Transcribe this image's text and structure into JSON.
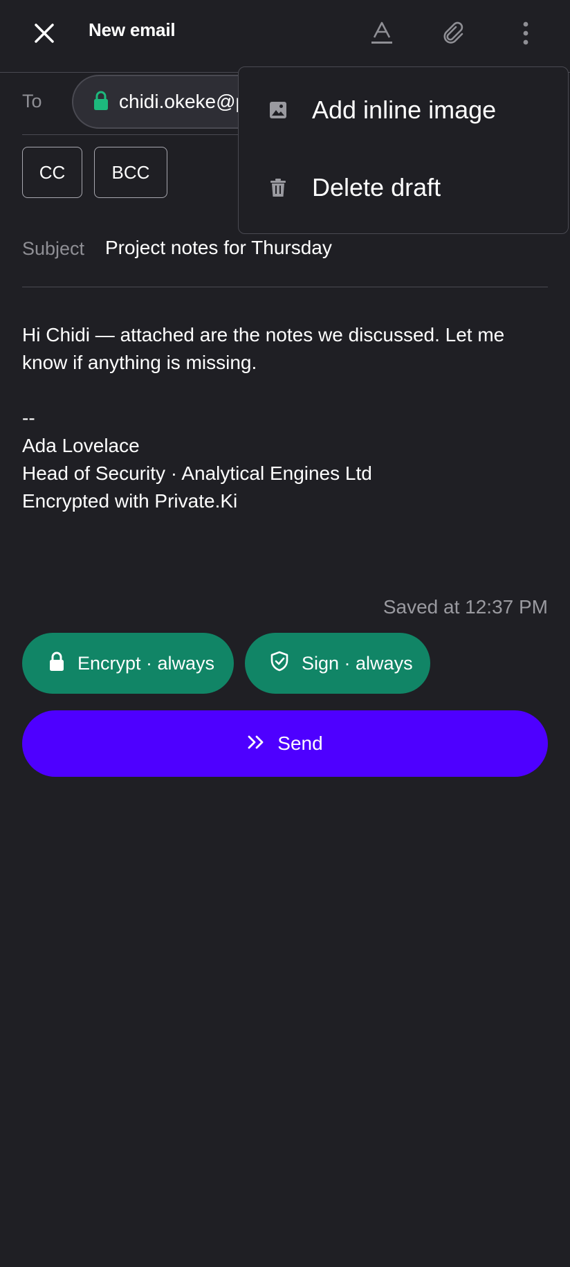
{
  "header": {
    "title": "New email",
    "close_icon": "close-icon",
    "format_icon": "text-format-icon",
    "attach_icon": "paperclip-icon",
    "more_icon": "more-vertical-icon"
  },
  "recipients": {
    "to_label": "To",
    "to_chip": "chidi.okeke@p",
    "cc_label": "CC",
    "bcc_label": "BCC"
  },
  "subject": {
    "label": "Subject",
    "value": "Project notes for Thursday"
  },
  "body": {
    "lines": [
      "Hi Chidi — attached are the notes we discussed. Let me",
      "know if anything is missing.",
      "",
      "--",
      "Ada Lovelace",
      "Head of Security · Analytical Engines Ltd",
      "Encrypted with Private.Ki"
    ]
  },
  "status": {
    "saved": "Saved at 12:37 PM"
  },
  "security": {
    "encrypt_label": "Encrypt · always",
    "sign_label": "Sign · always"
  },
  "actions": {
    "send_label": "Send"
  },
  "menu": {
    "items": [
      {
        "label": "Add inline image",
        "icon": "image-icon"
      },
      {
        "label": "Delete draft",
        "icon": "trash-icon"
      }
    ]
  },
  "colors": {
    "background": "#1f1f24",
    "accent_green": "#118566",
    "send_purple": "#4e00ff",
    "lock_green": "#1db97d"
  }
}
